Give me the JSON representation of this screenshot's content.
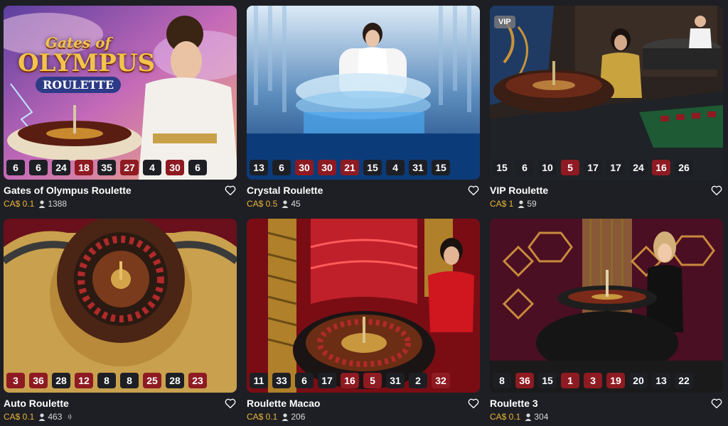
{
  "cards": [
    {
      "title": "Gates of Olympus Roulette",
      "bet": "CA$ 0.1",
      "players": "1388",
      "logo": {
        "line1": "Gates of",
        "line2": "OLYMPUS",
        "line3": "ROULETTE"
      },
      "results": [
        {
          "n": "6",
          "c": "black"
        },
        {
          "n": "6",
          "c": "black"
        },
        {
          "n": "24",
          "c": "black"
        },
        {
          "n": "18",
          "c": "red"
        },
        {
          "n": "35",
          "c": "black"
        },
        {
          "n": "27",
          "c": "red"
        },
        {
          "n": "4",
          "c": "black"
        },
        {
          "n": "30",
          "c": "red"
        },
        {
          "n": "6",
          "c": "black"
        }
      ]
    },
    {
      "title": "Crystal Roulette",
      "bet": "CA$ 0.5",
      "players": "45",
      "results": [
        {
          "n": "13",
          "c": "black"
        },
        {
          "n": "6",
          "c": "black"
        },
        {
          "n": "30",
          "c": "red"
        },
        {
          "n": "30",
          "c": "red"
        },
        {
          "n": "21",
          "c": "red"
        },
        {
          "n": "15",
          "c": "black"
        },
        {
          "n": "4",
          "c": "black"
        },
        {
          "n": "31",
          "c": "black"
        },
        {
          "n": "15",
          "c": "black"
        }
      ]
    },
    {
      "title": "VIP Roulette",
      "bet": "CA$ 1",
      "players": "59",
      "badge": "VIP",
      "results": [
        {
          "n": "15",
          "c": "black"
        },
        {
          "n": "6",
          "c": "black"
        },
        {
          "n": "10",
          "c": "black"
        },
        {
          "n": "5",
          "c": "red"
        },
        {
          "n": "17",
          "c": "black"
        },
        {
          "n": "17",
          "c": "black"
        },
        {
          "n": "24",
          "c": "black"
        },
        {
          "n": "16",
          "c": "red"
        },
        {
          "n": "26",
          "c": "black"
        }
      ]
    },
    {
      "title": "Auto Roulette",
      "bet": "CA$ 0.1",
      "players": "463",
      "has_sound": true,
      "results": [
        {
          "n": "3",
          "c": "red"
        },
        {
          "n": "36",
          "c": "red"
        },
        {
          "n": "28",
          "c": "black"
        },
        {
          "n": "12",
          "c": "red"
        },
        {
          "n": "8",
          "c": "black"
        },
        {
          "n": "8",
          "c": "black"
        },
        {
          "n": "25",
          "c": "red"
        },
        {
          "n": "28",
          "c": "black"
        },
        {
          "n": "23",
          "c": "red"
        }
      ]
    },
    {
      "title": "Roulette Macao",
      "bet": "CA$ 0.1",
      "players": "206",
      "results": [
        {
          "n": "11",
          "c": "black"
        },
        {
          "n": "33",
          "c": "black"
        },
        {
          "n": "6",
          "c": "black"
        },
        {
          "n": "17",
          "c": "black"
        },
        {
          "n": "16",
          "c": "red"
        },
        {
          "n": "5",
          "c": "red"
        },
        {
          "n": "31",
          "c": "black"
        },
        {
          "n": "2",
          "c": "black"
        },
        {
          "n": "32",
          "c": "red"
        }
      ]
    },
    {
      "title": "Roulette 3",
      "bet": "CA$ 0.1",
      "players": "304",
      "results": [
        {
          "n": "8",
          "c": "black"
        },
        {
          "n": "36",
          "c": "red"
        },
        {
          "n": "15",
          "c": "black"
        },
        {
          "n": "1",
          "c": "red"
        },
        {
          "n": "3",
          "c": "red"
        },
        {
          "n": "19",
          "c": "red"
        },
        {
          "n": "20",
          "c": "black"
        },
        {
          "n": "13",
          "c": "black"
        },
        {
          "n": "22",
          "c": "black"
        }
      ]
    }
  ],
  "icons": {
    "favorite": "heart-outline-icon",
    "players": "person-icon",
    "sound": "sound-icon"
  },
  "colors": {
    "bet": "#e8b53a",
    "red_number": "#8e1a22",
    "black_number": "#1d1f24"
  }
}
